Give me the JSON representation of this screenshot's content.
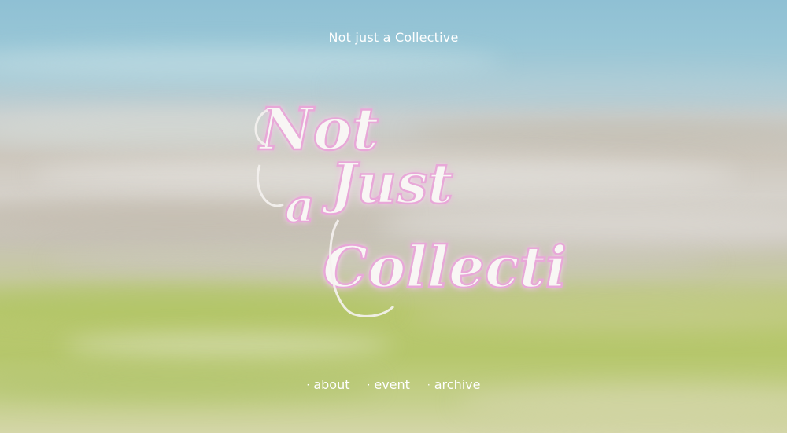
{
  "site": {
    "title": "Not just a Collective"
  },
  "logo": {
    "line1": "Not",
    "line2": "Just",
    "line3": "a",
    "line4": "Collective"
  },
  "nav": {
    "bullet": "·",
    "items": [
      {
        "label": "about"
      },
      {
        "label": "event"
      },
      {
        "label": "archive"
      }
    ]
  },
  "colors": {
    "text": "#ffffff",
    "logo_glow": "#e8a8d8"
  }
}
